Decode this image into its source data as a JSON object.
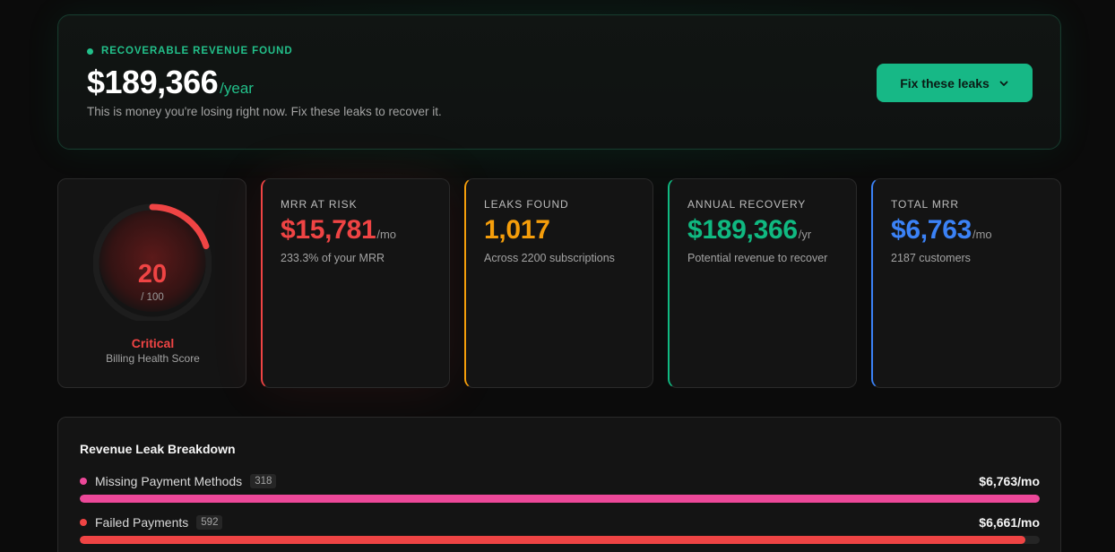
{
  "hero": {
    "eyebrow": "RECOVERABLE REVENUE FOUND",
    "amount": "$189,366",
    "unit": "/year",
    "subtitle": "This is money you're losing right now. Fix these leaks to recover it.",
    "button_label": "Fix these leaks",
    "accent": "#22c08a"
  },
  "score": {
    "value": "20",
    "denominator": "/ 100",
    "fraction": 0.2,
    "status": "Critical",
    "caption": "Billing Health Score",
    "color": "#ef4444"
  },
  "stats": [
    {
      "label": "MRR AT RISK",
      "value": "$15,781",
      "suffix": "/mo",
      "sub": "233.3% of your MRR",
      "color": "#ef4444"
    },
    {
      "label": "LEAKS FOUND",
      "value": "1,017",
      "suffix": "",
      "sub": "Across 2200 subscriptions",
      "color": "#f59e0b"
    },
    {
      "label": "ANNUAL RECOVERY",
      "value": "$189,366",
      "suffix": "/yr",
      "sub": "Potential revenue to recover",
      "color": "#10b981"
    },
    {
      "label": "TOTAL MRR",
      "value": "$6,763",
      "suffix": "/mo",
      "sub": "2187 customers",
      "color": "#3b82f6"
    }
  ],
  "breakdown": {
    "title": "Revenue Leak Breakdown",
    "items": [
      {
        "name": "Missing Payment Methods",
        "count": "318",
        "amount": "$6,763/mo",
        "fraction": 1.0,
        "color": "#ec4899"
      },
      {
        "name": "Failed Payments",
        "count": "592",
        "amount": "$6,661/mo",
        "fraction": 0.985,
        "color": "#ef4444"
      }
    ]
  }
}
